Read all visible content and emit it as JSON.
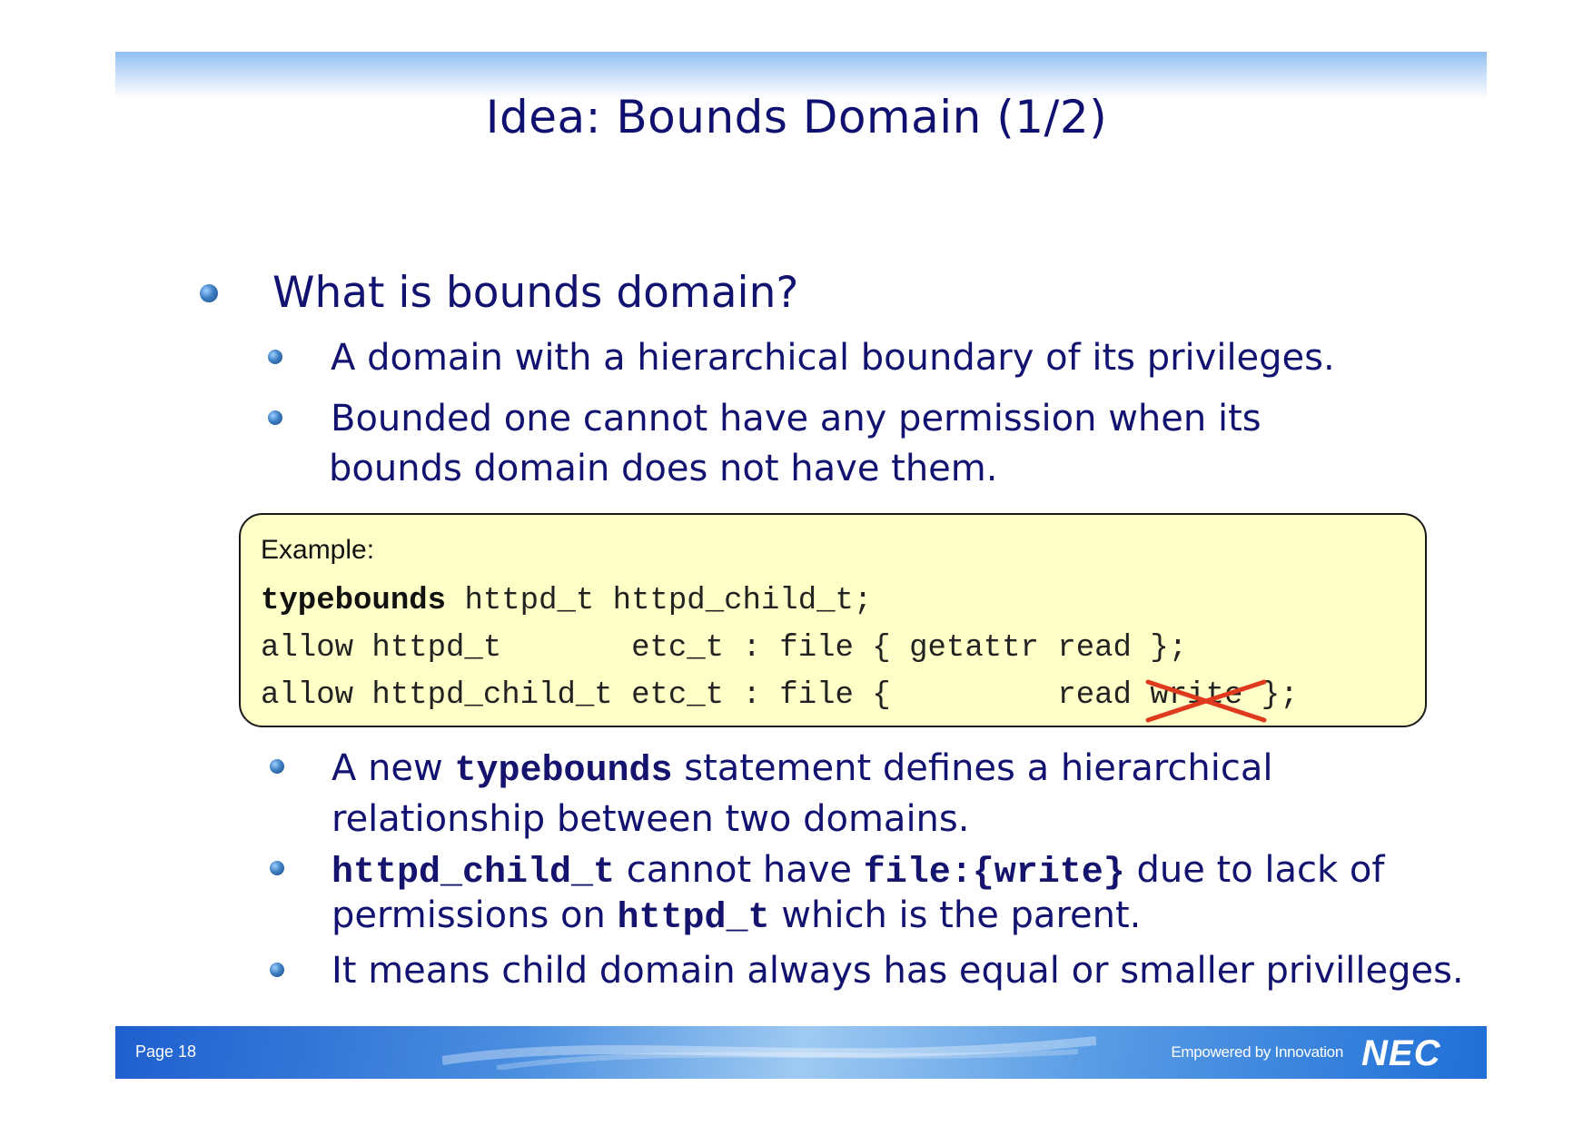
{
  "slide": {
    "title": "Idea: Bounds Domain (1/2)",
    "heading": "What is bounds domain?",
    "bullets_top": [
      "A domain with a hierarchical boundary of its privileges.",
      "Bounded one cannot have any permission when its",
      "bounds domain does not have them."
    ],
    "example": {
      "label": "Example:",
      "line1_keyword": "typebounds",
      "line1_rest": " httpd_t httpd_child_t;",
      "line2": "allow httpd_t       etc_t : file { getattr read };",
      "line3_before": "allow httpd_child_t etc_t : file {         read ",
      "line3_struck": "write",
      "line3_after": " };"
    },
    "bullets_bottom": {
      "b1_pre": "A new ",
      "b1_code": "typebounds",
      "b1_post": " statement defines a hierarchical",
      "b1_line2": "relationship between two domains.",
      "b2_code1": "httpd_child_t",
      "b2_mid": " cannot have ",
      "b2_code2": "file:{write}",
      "b2_post": " due to lack of",
      "b2_line2_pre": "permissions on ",
      "b2_line2_code": "httpd_t",
      "b2_line2_post": " which is the parent.",
      "b3": "It means child domain always has equal or smaller privilleges."
    }
  },
  "footer": {
    "page": "Page 18",
    "tagline": "Empowered by Innovation",
    "logo_text": "NEC"
  },
  "colors": {
    "title_text": "#101070",
    "body_text": "#121270",
    "code_box_bg": "#ffffc8",
    "strike_cross": "#e03a1e",
    "footer_blue": "#1e5fcf"
  },
  "icons": [
    "bullet-icon",
    "cross-out-icon",
    "nec-logo"
  ]
}
